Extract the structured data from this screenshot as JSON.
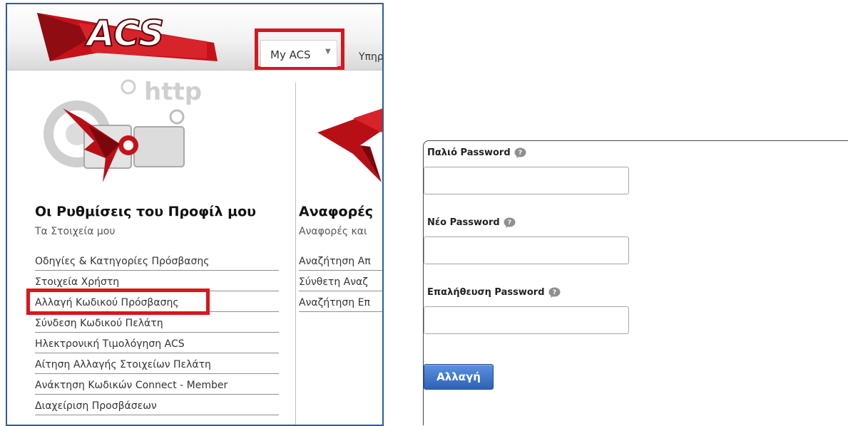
{
  "header": {
    "logo_text": "ACS",
    "tabs": [
      {
        "label": "My ACS"
      },
      {
        "label": "Υπηρ"
      }
    ]
  },
  "columns": [
    {
      "title": "Οι Ρυθμίσεις του Προφίλ μου",
      "subtitle": "Τα Στοιχεία μου",
      "illustration_text": "http",
      "links": [
        "Οδηγίες & Κατηγορίες Πρόσβασης",
        "Στοιχεία Χρήστη",
        "Αλλαγή Κωδικού Πρόσβασης",
        "Σύνδεση Κωδικού Πελάτη",
        "Ηλεκτρονική Τιμολόγηση ACS",
        "Αίτηση Αλλαγής Στοιχείων Πελάτη",
        "Ανάκτηση Κωδικών Connect - Member",
        "Διαχείριση Προσβάσεων"
      ]
    },
    {
      "title": "Αναφορές",
      "subtitle": "Αναφορές και",
      "links": [
        "Αναζήτηση Απ",
        "Σύνθετη Αναζ",
        "Αναζήτηση Επ"
      ]
    }
  ],
  "form": {
    "old_password_label": "Παλιό Password",
    "new_password_label": "Νέο Password",
    "confirm_password_label": "Επαλήθευση Password",
    "old_password_value": "",
    "new_password_value": "",
    "confirm_password_value": "",
    "submit_label": "Αλλαγή"
  },
  "colors": {
    "highlight": "#d9161e",
    "brand_red": "#c4121a",
    "button_blue": "#3a72c9"
  }
}
